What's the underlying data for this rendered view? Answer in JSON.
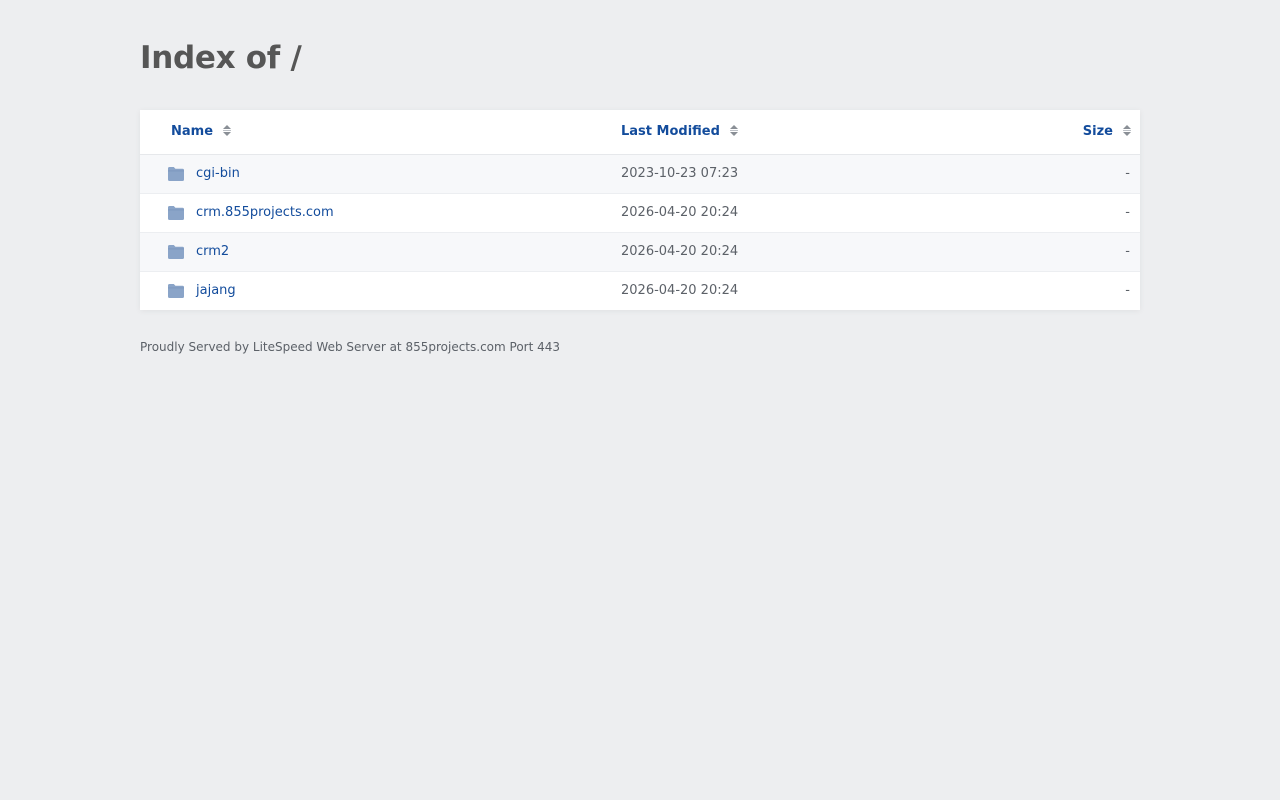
{
  "page": {
    "title": "Index of /"
  },
  "table": {
    "headers": {
      "name": "Name",
      "last_modified": "Last Modified",
      "size": "Size"
    },
    "rows": [
      {
        "name": "cgi-bin",
        "last_modified": "2023-10-23 07:23",
        "size": "-",
        "icon": "folder-icon"
      },
      {
        "name": "crm.855projects.com",
        "last_modified": "2026-04-20 20:24",
        "size": "-",
        "icon": "folder-icon"
      },
      {
        "name": "crm2",
        "last_modified": "2026-04-20 20:24",
        "size": "-",
        "icon": "folder-icon"
      },
      {
        "name": "jajang",
        "last_modified": "2026-04-20 20:24",
        "size": "-",
        "icon": "folder-icon"
      }
    ]
  },
  "footer": {
    "text": "Proudly Served by LiteSpeed Web Server at 855projects.com Port 443"
  },
  "colors": {
    "background": "#edeef0",
    "link": "#134c9c",
    "folder_icon": "#8aa4c8",
    "title": "#565656"
  }
}
